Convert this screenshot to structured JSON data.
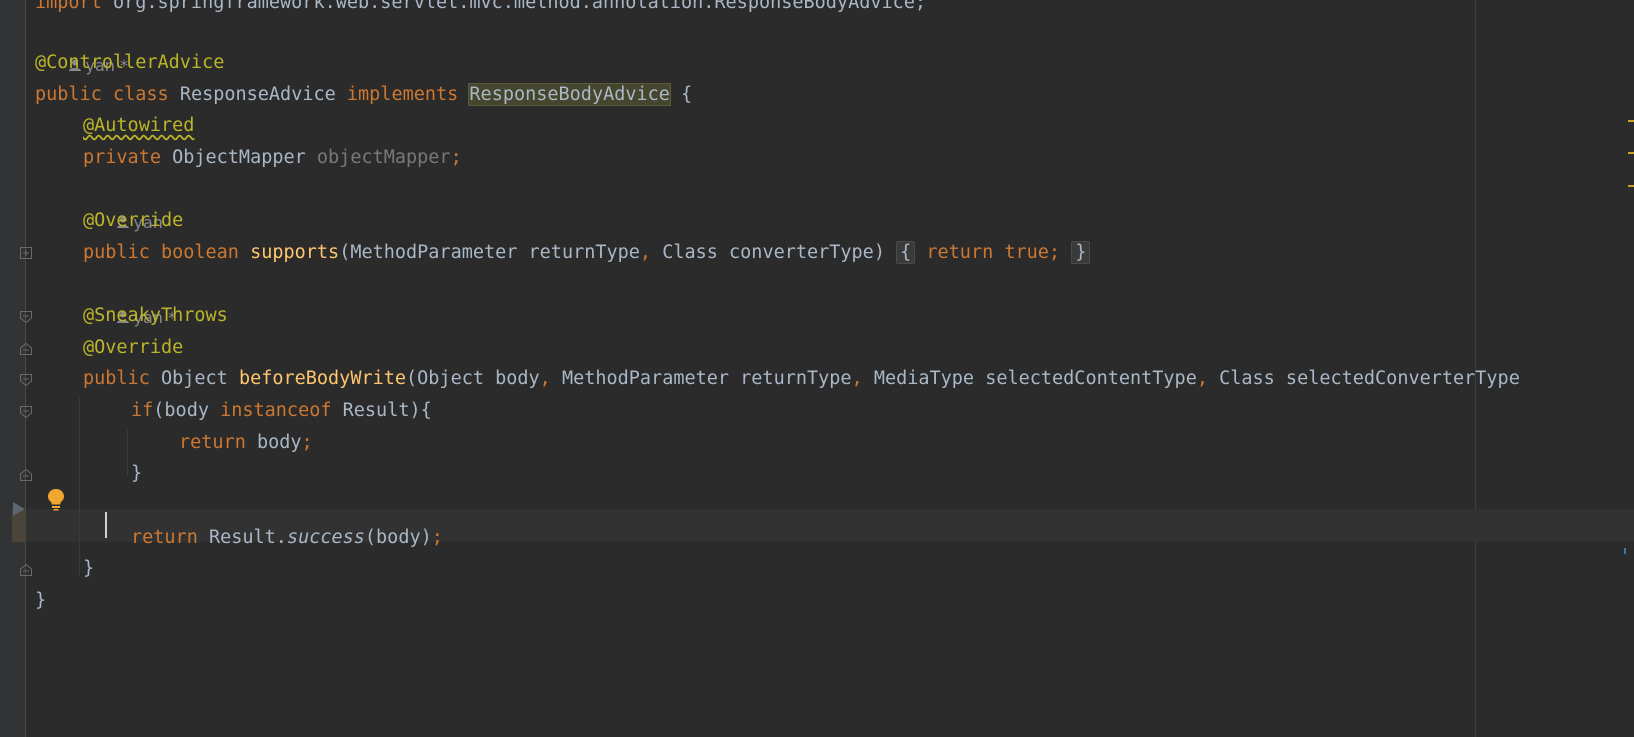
{
  "editor": {
    "lines": {
      "import_line": "import org.springframework.web.servlet.mvc.method.annotation.ResponseBodyAdvice;",
      "author1": "yan *",
      "controller_advice": "@ControllerAdvice",
      "class_public": "public",
      "class_kw": "class",
      "class_name": "ResponseAdvice",
      "implements_kw": "implements",
      "interface_name": "ResponseBodyAdvice",
      "open_brace": "{",
      "autowired": "@Autowired",
      "private_kw": "private",
      "field_type": "ObjectMapper",
      "field_name": "objectMapper",
      "semicolon": ";",
      "author2": "yan",
      "override1": "@Override",
      "supports_public": "public",
      "supports_boolean": "boolean",
      "supports_name": "supports",
      "supports_params_1": "(MethodParameter returnType",
      "comma": ",",
      "supports_params_2": " Class converterType)",
      "fold_open": "{",
      "fold_return": "return",
      "fold_true": "true;",
      "fold_close": "}",
      "author3": "yan *",
      "sneaky": "@SneakyThrows",
      "override2": "@Override",
      "bbw_public": "public",
      "bbw_type": "Object",
      "bbw_name": "beforeBodyWrite",
      "bbw_p1": "(Object body",
      "bbw_p2": " MethodParameter returnType",
      "bbw_p3": " MediaType selectedContentType",
      "bbw_p4": " Class selectedConverterType",
      "if_kw": "if",
      "if_body": "(body ",
      "instanceof_kw": "instanceof",
      "if_rest": " Result){",
      "return1_kw": "return",
      "return1_val": " body",
      "close_if": "}",
      "return2_kw": "return",
      "return2_obj": " Result.",
      "return2_method": "success",
      "return2_args": "(body)",
      "close_method": "}",
      "close_class": "}"
    },
    "colors": {
      "background": "#2b2b2b",
      "keyword": "#cc7832",
      "annotation": "#bbb529",
      "function": "#ffc66d",
      "text": "#a9b7c6"
    },
    "icons": {
      "author": "person-icon",
      "bulb": "lightbulb-icon",
      "fold": "fold-icon",
      "run": "run-arrow-icon"
    }
  }
}
